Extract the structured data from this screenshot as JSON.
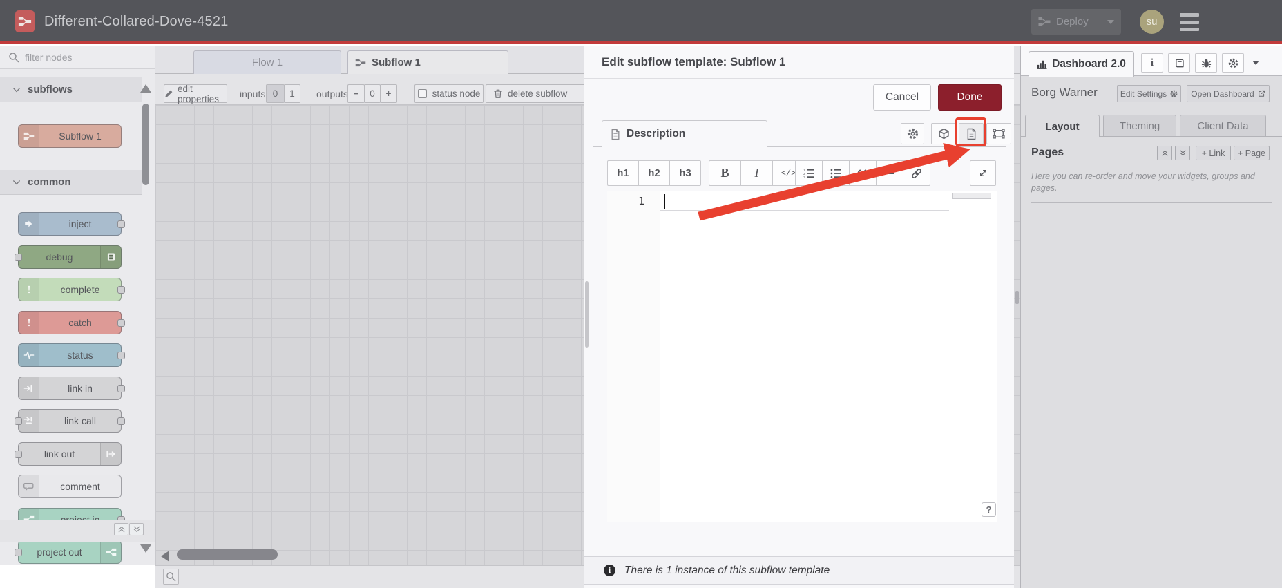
{
  "header": {
    "title": "Different-Collared-Dove-4521",
    "deploy_label": "Deploy",
    "avatar_initials": "su"
  },
  "palette": {
    "filter_placeholder": "filter nodes",
    "categories": [
      {
        "label": "subflows",
        "nodes": [
          {
            "label": "Subflow 1",
            "color": "#d8ab9e",
            "icon": "subflow-icon",
            "icon_side": "left",
            "ports": "none",
            "icon_color": "#f4ece9"
          }
        ]
      },
      {
        "label": "common",
        "nodes": [
          {
            "label": "inject",
            "color": "#a9bccd",
            "icon": "inject-icon",
            "icon_side": "left",
            "ports": "right",
            "icon_color": "#f2f4f7"
          },
          {
            "label": "debug",
            "color": "#8fa883",
            "icon": "debug-icon",
            "icon_side": "right",
            "ports": "left",
            "icon_color": "#eef2ec"
          },
          {
            "label": "complete",
            "color": "#c3dcba",
            "icon": "exclamation-icon",
            "icon_side": "left",
            "ports": "right",
            "icon_color": "#f4f8f2"
          },
          {
            "label": "catch",
            "color": "#dd9a96",
            "icon": "exclamation-icon",
            "icon_side": "left",
            "ports": "right",
            "icon_color": "#f8efee"
          },
          {
            "label": "status",
            "color": "#9fbecb",
            "icon": "status-icon",
            "icon_side": "left",
            "ports": "right",
            "icon_color": "#f0f5f7"
          },
          {
            "label": "link in",
            "color": "#d4d4d6",
            "icon": "link-in-icon",
            "icon_side": "left",
            "ports": "right",
            "icon_color": "#f6f6f7"
          },
          {
            "label": "link call",
            "color": "#d4d4d6",
            "icon": "link-call-icon",
            "icon_side": "left",
            "ports": "both",
            "icon_color": "#f6f6f7"
          },
          {
            "label": "link out",
            "color": "#d4d4d6",
            "icon": "link-out-icon",
            "icon_side": "right",
            "ports": "left",
            "icon_color": "#f6f6f7"
          },
          {
            "label": "comment",
            "color": "#e9e9ec",
            "icon": "comment-icon",
            "icon_side": "left",
            "ports": "none",
            "icon_color": "#9a9a9e"
          },
          {
            "label": "project in",
            "color": "#a8d3c2",
            "icon": "node-red-icon",
            "icon_side": "left",
            "ports": "right",
            "icon_color": "#f1f8f5"
          },
          {
            "label": "project out",
            "color": "#a8d3c2",
            "icon": "node-red-icon",
            "icon_side": "right",
            "ports": "left",
            "icon_color": "#f1f8f5"
          }
        ]
      }
    ]
  },
  "workspace": {
    "tabs": [
      {
        "label": "Flow 1"
      },
      {
        "label": "Subflow 1"
      }
    ],
    "toolbar": {
      "edit_properties_label": "edit properties",
      "inputs_label": "inputs:",
      "input_zero": "0",
      "input_one": "1",
      "outputs_label": "outputs:",
      "minus": "−",
      "output_count": "0",
      "plus": "+",
      "status_node_label": "status node",
      "delete_label": "delete subflow"
    }
  },
  "dialog": {
    "title": "Edit subflow template: Subflow 1",
    "cancel_label": "Cancel",
    "done_label": "Done",
    "tab_label": "Description",
    "line_number": "1",
    "help_label": "?",
    "footer_text": "There is 1 instance of this subflow template"
  },
  "markdown_toolbar": {
    "h1": "h1",
    "h2": "h2",
    "h3": "h3",
    "bold": "B",
    "italic": "I",
    "code": "</>"
  },
  "sidebar": {
    "tab_label": "Dashboard 2.0",
    "project_name": "Borg Warner",
    "edit_settings_label": "Edit Settings",
    "open_dashboard_label": "Open Dashboard",
    "tabs": [
      {
        "label": "Layout"
      },
      {
        "label": "Theming"
      },
      {
        "label": "Client Data"
      }
    ],
    "pages_label": "Pages",
    "add_link_label": "+ Link",
    "add_page_label": "+ Page",
    "help_text": "Here you can re-order and move your widgets, groups and pages."
  },
  "colors": {
    "header_accent_line": "#c23b3b",
    "done_button": "#8c1f2c",
    "annotation_red": "#e8402f"
  }
}
